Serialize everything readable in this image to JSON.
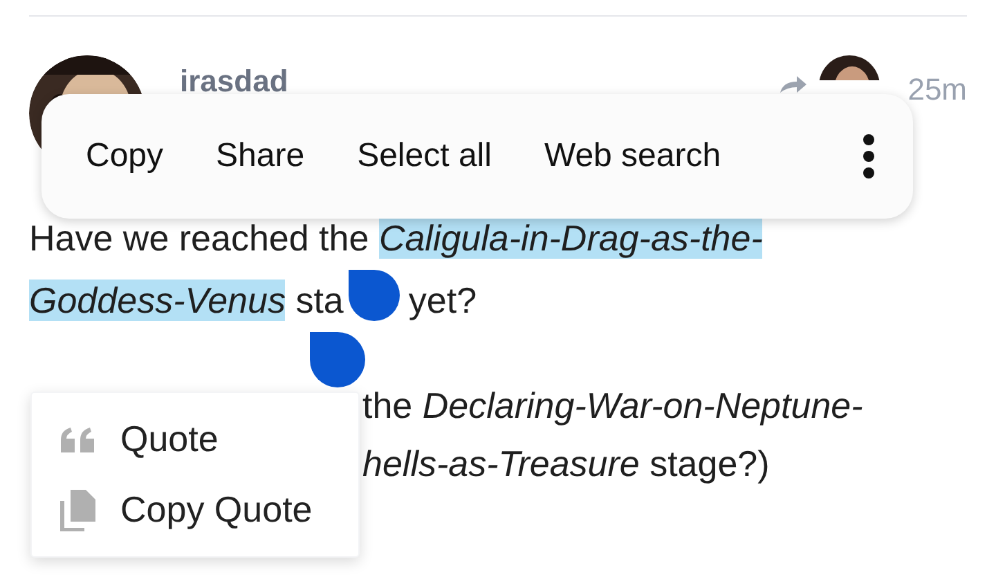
{
  "post": {
    "author": "irasdad",
    "time": "25m",
    "paragraph_1": [
      [
        {
          "text": "Have we reached the ",
          "italic": false,
          "selected": false
        },
        {
          "text": "Caligula-in-Drag-as-the-",
          "italic": true,
          "selected": true
        }
      ],
      [
        {
          "text": "Goddess-Venus",
          "italic": true,
          "selected": true
        },
        {
          "text": " sta",
          "italic": false,
          "selected": false,
          "kind": "handle-after"
        },
        {
          "text": "yet?",
          "italic": false,
          "selected": false
        }
      ]
    ],
    "paragraph_2": [
      [
        {
          "text": "the ",
          "italic": false,
          "selected": false
        },
        {
          "text": "Declaring-War-on-Neptune-",
          "italic": true,
          "selected": false
        }
      ],
      [
        {
          "text": "hells-as-Treasure",
          "italic": true,
          "selected": false
        },
        {
          "text": " stage?)",
          "italic": false,
          "selected": false
        }
      ]
    ]
  },
  "text_toolbar": {
    "items": [
      "Copy",
      "Share",
      "Select all",
      "Web search"
    ]
  },
  "quote_menu": {
    "items": [
      {
        "kind": "quote",
        "label": "Quote"
      },
      {
        "kind": "copy",
        "label": "Copy Quote"
      }
    ]
  }
}
